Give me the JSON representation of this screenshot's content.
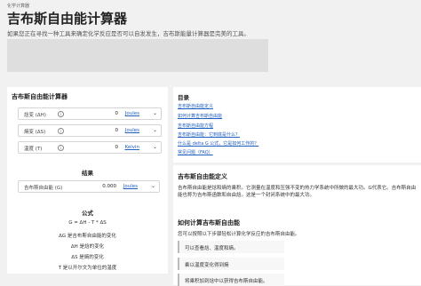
{
  "breadcrumb": "化学计算器",
  "page": {
    "title": "吉布斯自由能计算器",
    "subtitle": "如果您正在寻找一种工具来确定化学反应是否可以自发发生，吉布斯能量计算器是完美的工具。"
  },
  "calculator": {
    "title": "吉布斯自由能计算器",
    "rows": [
      {
        "label": "焓变 (ΔH)",
        "value": "0",
        "unit": "Joules"
      },
      {
        "label": "熵变 (ΔS)",
        "value": "0",
        "unit": "Joules"
      },
      {
        "label": "温度 (T)",
        "value": "0",
        "unit": "Kelvin"
      }
    ],
    "result_heading": "结果",
    "result_row": {
      "label": "吉布斯自由能 (G)",
      "value": "0.000",
      "unit": "Joules"
    },
    "formula_heading": "公式",
    "formula_lines": [
      "G = ΔH - T * ΔS",
      "ΔG 是吉布斯自由能的变化",
      "ΔH 是焓的变化",
      "ΔS 是熵的变化",
      "T 是以开尔文为单位的温度"
    ]
  },
  "toc": {
    "title": "目录",
    "items": [
      "吉布斯自由能定义",
      "如何计算吉布斯自由能",
      "吉布斯自由能方程",
      "吉布斯自由能：它到底是什么？",
      "什么是 delta G 公式，它是如何工作的？",
      "常见问题（FAQ）"
    ]
  },
  "article": {
    "def_heading": "吉布斯自由能定义",
    "def_text": "吉布斯自由能是焓和熵的乘积。它测量在温度和压强不变的热力学系统中所做的最大功。G代表它。吉布斯自由能也称为吉布斯函数和自由焓。这是一个封闭系统中的最大功。",
    "how_heading": "如何计算吉布斯自由能",
    "how_text": "您可以按照以下步骤轻松计算化学反应的吉布斯自由能。",
    "steps": [
      "可以查看焓、温度和熵。",
      "乘以温度变化得到熵",
      "将乘积加到焓中以获得吉布斯自由能。"
    ]
  }
}
